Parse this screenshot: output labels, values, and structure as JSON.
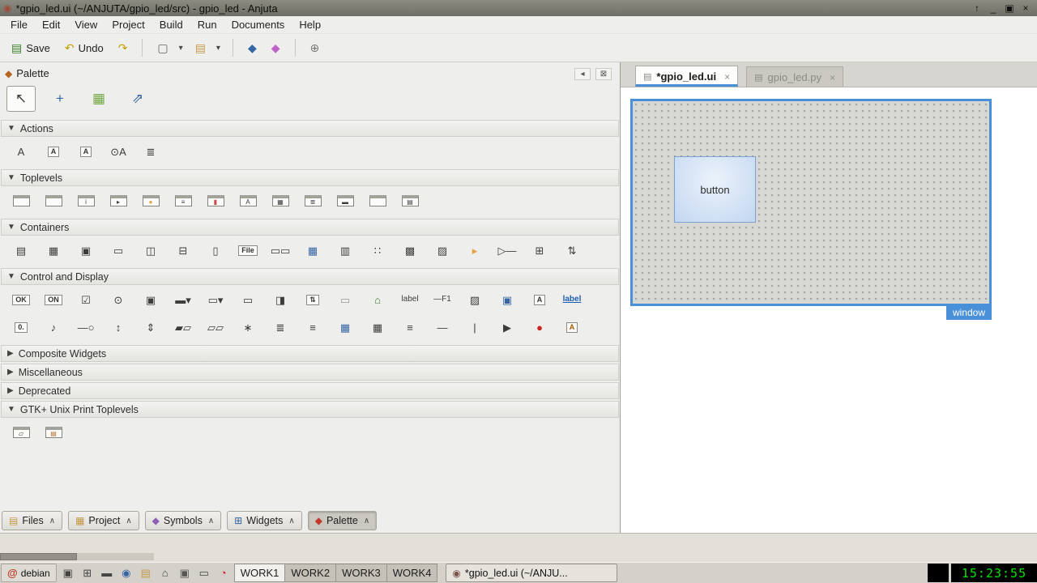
{
  "title_bar": {
    "app_icon": "◉",
    "title": "*gpio_led.ui (~/ANJUTA/gpio_led/src) - gpio_led - Anjuta",
    "controls": [
      {
        "name": "keep-above-icon",
        "g": "↑"
      },
      {
        "name": "minimize-icon",
        "g": "_"
      },
      {
        "name": "maximize-icon",
        "g": "▣"
      },
      {
        "name": "close-icon",
        "g": "×"
      }
    ]
  },
  "menubar": {
    "items": [
      "File",
      "Edit",
      "View",
      "Project",
      "Build",
      "Run",
      "Documents",
      "Help"
    ]
  },
  "toolbar": {
    "arrow_glyph": "▾",
    "buttons": [
      {
        "name": "save-button",
        "g": "▤",
        "c": "#3a7d2c",
        "label": "Save"
      },
      {
        "name": "undo-button",
        "g": "↶",
        "c": "#c4a000",
        "label": "Undo"
      },
      {
        "name": "redo-button",
        "g": "↷",
        "c": "#c4a000",
        "label": ""
      }
    ],
    "dropdowns": [
      {
        "name": "new-file-button",
        "g": "▢",
        "c": "#666666"
      },
      {
        "name": "open-file-button",
        "g": "▤",
        "c": "#c49a4a"
      }
    ],
    "group2": [
      {
        "name": "build-icon",
        "g": "◆",
        "c": "#3465a4"
      },
      {
        "name": "run-configure-icon",
        "g": "◆",
        "c": "#c061cb"
      }
    ],
    "group3": [
      {
        "name": "preferences-icon",
        "g": "⊕",
        "c": "#777777"
      }
    ]
  },
  "palette": {
    "header_glyph": "◆",
    "header": "Palette",
    "header_buttons": [
      {
        "name": "dock-arrow-icon",
        "g": "◂"
      },
      {
        "name": "close-pane-icon",
        "g": "⊠"
      }
    ],
    "selectors": [
      {
        "name": "selector-pointer-icon",
        "g": "↖",
        "active": true
      },
      {
        "name": "drag-resize-icon",
        "g": "+",
        "c": "#3465a4"
      },
      {
        "name": "margins-edit-icon",
        "g": "▦",
        "c": "#73a946"
      },
      {
        "name": "align-edit-icon",
        "g": "⇗",
        "c": "#3465a4"
      }
    ],
    "sections": [
      {
        "label": "Actions",
        "arrow": "▼",
        "expanded": true,
        "icons": [
          {
            "name": "action-icon",
            "g": "A"
          },
          {
            "name": "toggle-action-icon",
            "g": "A",
            "cls": "bx"
          },
          {
            "name": "radio-action-icon",
            "g": "A",
            "cls": "bx"
          },
          {
            "name": "recent-action-icon",
            "g": "⊙A"
          },
          {
            "name": "action-group-icon",
            "g": "≣"
          }
        ]
      },
      {
        "label": "Toplevels",
        "arrow": "▼",
        "expanded": true,
        "icons": [
          {
            "name": "window-icon",
            "cls": "win",
            "g": ""
          },
          {
            "name": "dialog-icon",
            "cls": "win",
            "g": ""
          },
          {
            "name": "about-dialog-icon",
            "cls": "win",
            "g": "i"
          },
          {
            "name": "assistant-icon",
            "cls": "win",
            "g": "▸"
          },
          {
            "name": "message-dialog-icon",
            "cls": "win",
            "g": "●",
            "c": "#e8a33d"
          },
          {
            "name": "file-chooser-dialog-icon",
            "cls": "win",
            "g": "≡"
          },
          {
            "name": "color-chooser-dialog-icon",
            "cls": "win",
            "g": "▮",
            "c": "#cc4444"
          },
          {
            "name": "font-chooser-dialog-icon",
            "cls": "win",
            "g": "A"
          },
          {
            "name": "app-chooser-dialog-icon",
            "cls": "win",
            "g": "▦"
          },
          {
            "name": "recent-chooser-dialog-icon",
            "cls": "win",
            "g": "≣"
          },
          {
            "name": "input-dialog-icon",
            "cls": "win",
            "g": "▬"
          },
          {
            "name": "offscreen-window-icon",
            "cls": "win",
            "g": ""
          },
          {
            "name": "application-window-icon",
            "cls": "win",
            "g": "▤"
          }
        ]
      },
      {
        "label": "Containers",
        "arrow": "▼",
        "expanded": true,
        "icons": [
          {
            "name": "box-icon",
            "g": "▤"
          },
          {
            "name": "grid-icon",
            "g": "▦"
          },
          {
            "name": "notebook-icon",
            "g": "▣"
          },
          {
            "name": "frame-icon",
            "g": "▭"
          },
          {
            "name": "paned-horizontal-icon",
            "g": "◫"
          },
          {
            "name": "paned-vertical-icon",
            "g": "⊟"
          },
          {
            "name": "aspect-frame-icon",
            "g": "▯"
          },
          {
            "name": "file-chooser-button-icon",
            "g": "File",
            "cls": "bx"
          },
          {
            "name": "button-box-icon",
            "g": "▭▭"
          },
          {
            "name": "toolbar-icon",
            "g": "▦",
            "c": "#3465a4"
          },
          {
            "name": "viewport-icon",
            "g": "▥"
          },
          {
            "name": "button-box-vertical-icon",
            "g": "∷"
          },
          {
            "name": "scrolled-window-icon",
            "g": "▩"
          },
          {
            "name": "tool-palette-icon",
            "g": "▨"
          },
          {
            "name": "revealer-icon",
            "g": "▸",
            "c": "#e8a33d"
          },
          {
            "name": "expander-icon",
            "g": "▷—"
          },
          {
            "name": "overlay-icon",
            "g": "⊞"
          },
          {
            "name": "size-group-icon",
            "g": "⇅"
          }
        ]
      },
      {
        "label": "Control and Display",
        "arrow": "▼",
        "expanded": true,
        "icons": [
          {
            "name": "button-icon",
            "g": "OK",
            "cls": "bx"
          },
          {
            "name": "toggle-button-icon",
            "g": "ON",
            "cls": "bx"
          },
          {
            "name": "check-button-icon",
            "g": "☑"
          },
          {
            "name": "radio-button-icon",
            "g": "⊙"
          },
          {
            "name": "menu-button-icon",
            "g": "▣"
          },
          {
            "name": "combo-box-icon",
            "g": "▬▾"
          },
          {
            "name": "combo-box-entry-icon",
            "g": "▭▾"
          },
          {
            "name": "entry-icon",
            "g": "▭"
          },
          {
            "name": "switch-icon",
            "g": "◨"
          },
          {
            "name": "spin-button-icon",
            "g": "⇅",
            "cls": "bx"
          },
          {
            "name": "search-entry-icon",
            "g": "▭",
            "c": "#999999"
          },
          {
            "name": "home-button-icon",
            "g": "⌂",
            "c": "#3a7d2c"
          },
          {
            "name": "label-icon",
            "g": "label",
            "cls": "lab"
          },
          {
            "name": "accel-label-icon",
            "g": "—F1",
            "cls": "lab"
          },
          {
            "name": "image-icon",
            "g": "▨"
          },
          {
            "name": "image-button-icon",
            "g": "▣",
            "c": "#3465a4"
          },
          {
            "name": "text-frame-icon",
            "g": "A",
            "cls": "bx"
          },
          {
            "name": "link-button-icon",
            "g": "label",
            "cls": "link",
            "c": "#1a5fb4"
          },
          {
            "name": "scale-button-icon",
            "g": "0.",
            "cls": "bx"
          },
          {
            "name": "volume-button-icon",
            "g": "♪"
          },
          {
            "name": "scale-icon",
            "g": "—○"
          },
          {
            "name": "scale-vertical-icon",
            "g": "↕"
          },
          {
            "name": "scrollbar-icon",
            "g": "⇕"
          },
          {
            "name": "progress-bar-icon",
            "g": "▰▱"
          },
          {
            "name": "level-bar-icon",
            "g": "▱▱"
          },
          {
            "name": "spinner-icon",
            "g": "∗"
          },
          {
            "name": "text-view-icon",
            "g": "≣"
          },
          {
            "name": "tree-view-icon",
            "g": "≡"
          },
          {
            "name": "icon-view-icon",
            "g": "▦",
            "c": "#3465a4"
          },
          {
            "name": "calendar-icon",
            "g": "▦"
          },
          {
            "name": "list-box-icon",
            "g": "≡"
          },
          {
            "name": "separator-icon",
            "g": "—"
          },
          {
            "name": "separator-vertical-icon",
            "g": "|"
          },
          {
            "name": "media-play-icon",
            "g": "▶"
          },
          {
            "name": "color-button-icon",
            "g": "●",
            "c": "#cc2222"
          },
          {
            "name": "font-button-icon",
            "g": "A",
            "cls": "bx",
            "c": "#a05a00"
          }
        ]
      },
      {
        "label": "Composite Widgets",
        "arrow": "▶",
        "expanded": false,
        "icons": []
      },
      {
        "label": "Miscellaneous",
        "arrow": "▶",
        "expanded": false,
        "icons": []
      },
      {
        "label": "Deprecated",
        "arrow": "▶",
        "expanded": false,
        "icons": []
      },
      {
        "label": "GTK+ Unix Print Toplevels",
        "arrow": "▼",
        "expanded": true,
        "icons": [
          {
            "name": "page-setup-dialog-icon",
            "cls": "win",
            "g": "▱"
          },
          {
            "name": "print-dialog-icon",
            "cls": "win",
            "g": "▤",
            "c": "#b06f2a"
          }
        ]
      }
    ]
  },
  "dock_chevron": "∧",
  "dock_tabs": [
    {
      "name": "dock-tab-files",
      "label": "Files",
      "g": "▤",
      "c": "#c49a4a"
    },
    {
      "name": "dock-tab-project",
      "label": "Project",
      "g": "▦",
      "c": "#c49a4a"
    },
    {
      "name": "dock-tab-symbols",
      "label": "Symbols",
      "g": "◆",
      "c": "#8a5fb4"
    },
    {
      "name": "dock-tab-widgets",
      "label": "Widgets",
      "g": "⊞",
      "c": "#3465a4"
    },
    {
      "name": "dock-tab-palette",
      "label": "Palette",
      "g": "◆",
      "c": "#c0392b",
      "active": true
    }
  ],
  "editor": {
    "file_glyph": "▤",
    "close_glyph": "×",
    "tabs": [
      {
        "name": "tab-gpio-led-ui",
        "label": "*gpio_led.ui",
        "active": true
      },
      {
        "name": "tab-gpio-led-py",
        "label": "gpio_led.py",
        "active": false
      }
    ],
    "canvas": {
      "button_label": "button",
      "window_label": "window"
    }
  },
  "taskbar": {
    "menu_glyph": "@",
    "menu_label": "debian",
    "tray_icons": [
      {
        "name": "show-desktop-icon",
        "g": "▣"
      },
      {
        "name": "pager-icon",
        "g": "⊞"
      },
      {
        "name": "terminal-icon",
        "g": "▬"
      },
      {
        "name": "browser-icon",
        "g": "◉",
        "c": "#3465a4"
      },
      {
        "name": "file-manager-icon",
        "g": "▤",
        "c": "#c49a4a"
      },
      {
        "name": "home-icon",
        "g": "⌂"
      },
      {
        "name": "editor-icon",
        "g": "▣",
        "c": "#555555"
      },
      {
        "name": "monitor-icon",
        "g": "▭"
      },
      {
        "name": "clock-app-icon",
        "g": "◔",
        "c": "#cc2222"
      }
    ],
    "workspaces": [
      {
        "name": "workspace-work1",
        "label": "WORK1",
        "active": true
      },
      {
        "name": "workspace-work2",
        "label": "WORK2"
      },
      {
        "name": "workspace-work3",
        "label": "WORK3"
      },
      {
        "name": "workspace-work4",
        "label": "WORK4"
      }
    ],
    "task_glyph": "◉",
    "task_label": "*gpio_led.ui (~/ANJU...",
    "clock": "15:23:55"
  }
}
